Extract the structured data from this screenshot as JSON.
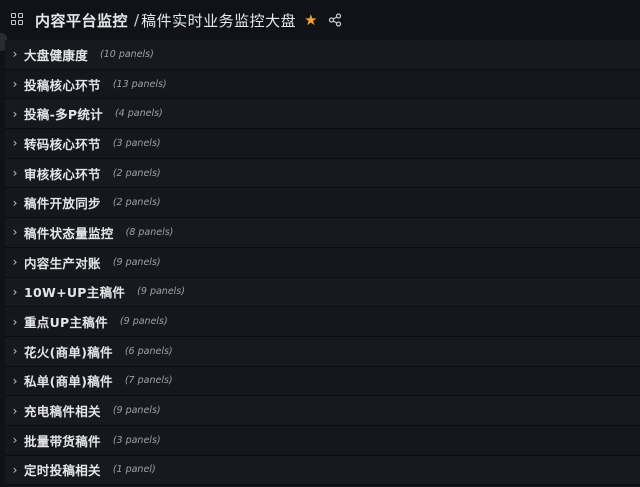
{
  "header": {
    "root_label": "内容平台监控",
    "separator": "/",
    "dashboard_title": "稿件实时业务监控大盘"
  },
  "colors": {
    "star": "#f5a623",
    "background": "#111217"
  },
  "rows": [
    {
      "title": "大盘健康度",
      "count": "(10 panels)"
    },
    {
      "title": "投稿核心环节",
      "count": "(13 panels)"
    },
    {
      "title": "投稿-多P统计",
      "count": "(4 panels)"
    },
    {
      "title": "转码核心环节",
      "count": "(3 panels)"
    },
    {
      "title": "审核核心环节",
      "count": "(2 panels)"
    },
    {
      "title": "稿件开放同步",
      "count": "(2 panels)"
    },
    {
      "title": "稿件状态量监控",
      "count": "(8 panels)"
    },
    {
      "title": "内容生产对账",
      "count": "(9 panels)"
    },
    {
      "title": "10W+UP主稿件",
      "count": "(9 panels)"
    },
    {
      "title": "重点UP主稿件",
      "count": "(9 panels)"
    },
    {
      "title": "花火(商单)稿件",
      "count": "(6 panels)"
    },
    {
      "title": "私单(商单)稿件",
      "count": "(7 panels)"
    },
    {
      "title": "充电稿件相关",
      "count": "(9 panels)"
    },
    {
      "title": "批量带货稿件",
      "count": "(3 panels)"
    },
    {
      "title": "定时投稿相关",
      "count": "(1 panel)"
    }
  ]
}
